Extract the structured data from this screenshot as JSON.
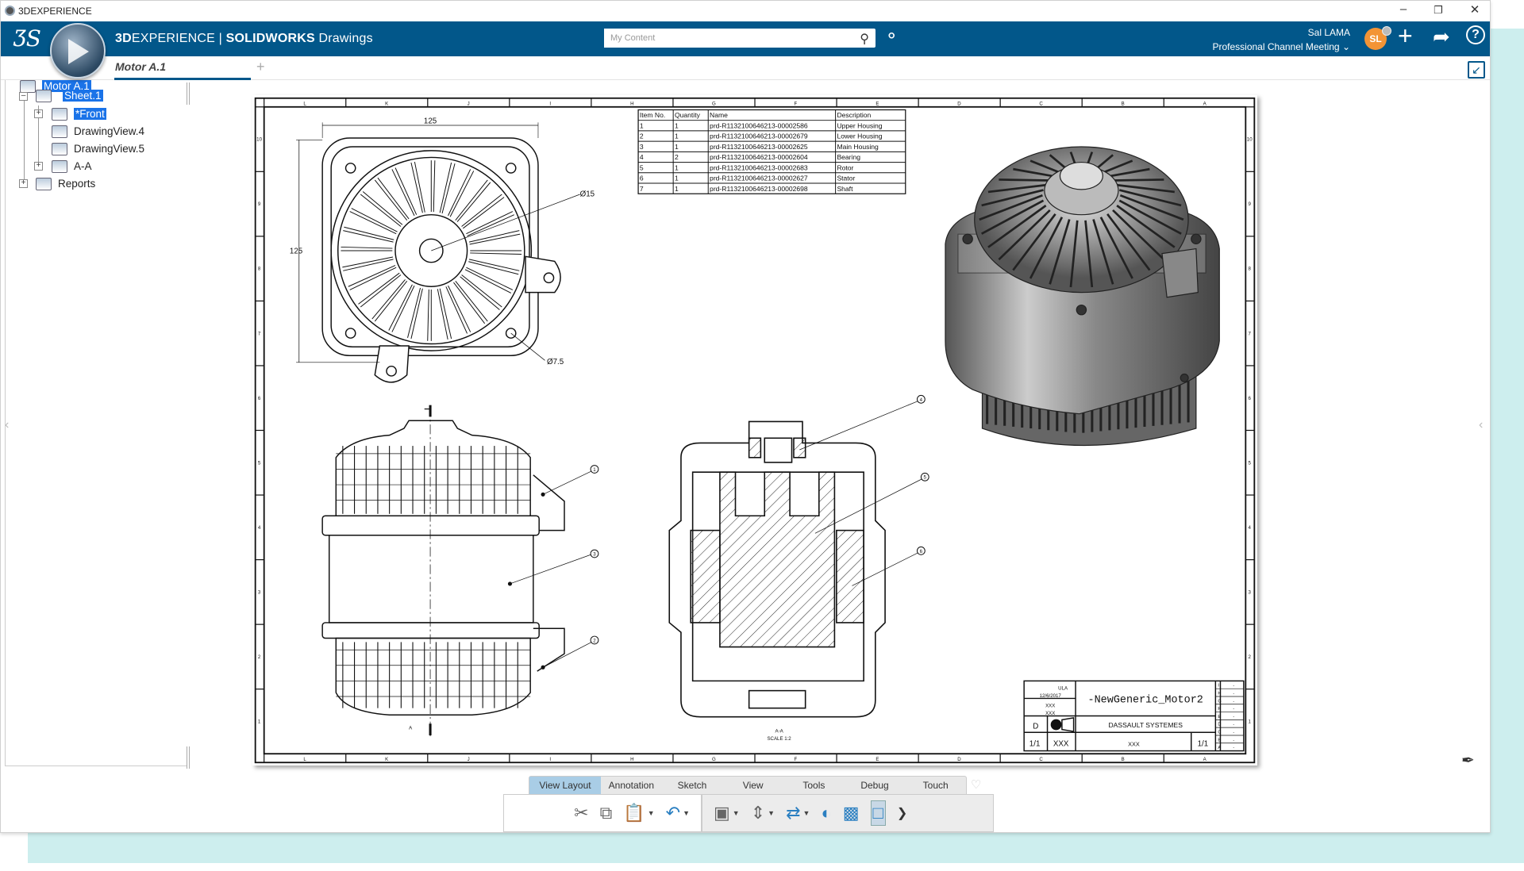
{
  "window": {
    "title": "3DEXPERIENCE",
    "controls": {
      "minimize": "–",
      "restore": "❐",
      "close": "✕"
    }
  },
  "header": {
    "brand_prefix": "3D",
    "brand_mid": "EXPERIENCE | ",
    "brand_app": "SOLIDWORKS",
    "brand_suffix": " Drawings",
    "logo": "3DS",
    "search_placeholder": "My Content",
    "user_name": "Sal LAMA",
    "workspace": "Professional Channel Meeting",
    "avatar_initials": "SL",
    "icons": [
      "tag-icon",
      "plus-icon",
      "share-icon",
      "help-icon"
    ],
    "brand_color": "#02578a",
    "avatar_color": "#f39436"
  },
  "tabs": [
    {
      "label": "Motor A.1",
      "active": true
    }
  ],
  "tree": {
    "items": [
      {
        "label": "Motor A.1",
        "selected": true
      },
      {
        "label": "Sheet.1",
        "selected": true
      },
      {
        "label": "*Front",
        "selected": true
      },
      {
        "label": "DrawingView.4",
        "selected": false
      },
      {
        "label": "DrawingView.5",
        "selected": false
      },
      {
        "label": "A-A",
        "selected": false
      },
      {
        "label": "Reports",
        "selected": false
      }
    ]
  },
  "drawing": {
    "zones_h": [
      "L",
      "K",
      "J",
      "I",
      "H",
      "G",
      "F",
      "E",
      "D",
      "C",
      "B",
      "A"
    ],
    "zones_v": [
      "10",
      "9",
      "8",
      "7",
      "6",
      "5",
      "4",
      "3",
      "2",
      "1"
    ],
    "dims": {
      "width": "125",
      "height": "125",
      "dia_large": "Ø15",
      "dia_small": "Ø7.5"
    },
    "balloons_front": [
      "1",
      "3",
      "2"
    ],
    "balloons_section": [
      "4",
      "5",
      "6"
    ],
    "section_label": "A-A",
    "section_scale": "SCALE 1:2",
    "section_mark": "A",
    "bom": {
      "headers": [
        "Item No.",
        "Quantity",
        "Name",
        "Description"
      ],
      "rows": [
        [
          "1",
          "1",
          "prd-R1132100646213-00002586",
          "Upper Housing"
        ],
        [
          "2",
          "1",
          "prd-R1132100646213-00002679",
          "Lower Housing"
        ],
        [
          "3",
          "1",
          "prd-R1132100646213-00002625",
          "Main Housing"
        ],
        [
          "4",
          "2",
          "prd-R1132100646213-00002604",
          "Bearing"
        ],
        [
          "5",
          "1",
          "prd-R1132100646213-00002683",
          "Rotor"
        ],
        [
          "6",
          "1",
          "prd-R1132100646213-00002627",
          "Stator"
        ],
        [
          "7",
          "1",
          "prd-R1132100646213-00002698",
          "Shaft"
        ]
      ]
    },
    "title_block": {
      "drawn_by": "ULA",
      "date": "12/6/2017",
      "checked_by": "XXX",
      "checked_date": "XXX",
      "size": "D",
      "title": "-NewGeneric_Motor2",
      "company": "DASSAULT SYSTEMES",
      "scale": "1/1",
      "weight": "XXX",
      "drawing_number": "XXX",
      "sheet": "1/1",
      "revisions": [
        "I",
        "H",
        "G",
        "F",
        "E",
        "D",
        "C",
        "B",
        "A"
      ],
      "rev_value": "-"
    }
  },
  "ribbon": {
    "tabs": [
      "View Layout",
      "Annotation",
      "Sketch",
      "View",
      "Tools",
      "Debug",
      "Touch"
    ],
    "active_tab": "View Layout"
  }
}
